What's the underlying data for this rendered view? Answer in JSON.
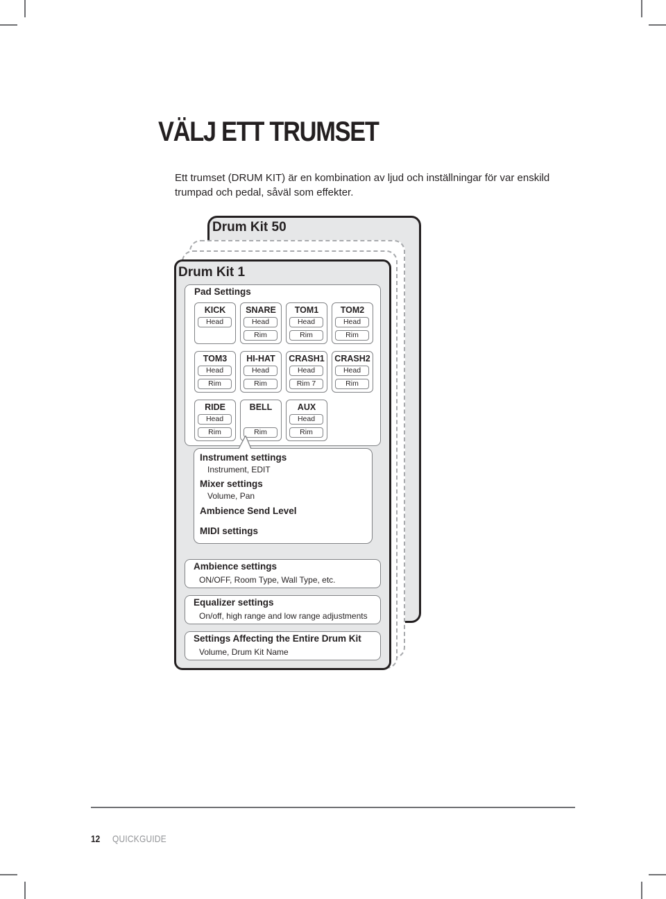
{
  "page": {
    "title": "VÄLJ ETT TRUMSET",
    "intro": "Ett trumset (DRUM KIT) är en kombination av ljud och inställningar för var enskild trumpad och pedal, såväl som effekter.",
    "footer": {
      "page_number": "12",
      "label": "QUICKGUIDE"
    }
  },
  "diagram": {
    "back_kit_title": "Drum Kit 50",
    "front_kit_title": "Drum Kit 1",
    "pad_settings_label": "Pad Settings",
    "pads": [
      {
        "name": "KICK",
        "head": "Head",
        "rim": null
      },
      {
        "name": "SNARE",
        "head": "Head",
        "rim": "Rim"
      },
      {
        "name": "TOM1",
        "head": "Head",
        "rim": "Rim"
      },
      {
        "name": "TOM2",
        "head": "Head",
        "rim": "Rim"
      },
      {
        "name": "TOM3",
        "head": "Head",
        "rim": "Rim"
      },
      {
        "name": "HI-HAT",
        "head": "Head",
        "rim": "Rim"
      },
      {
        "name": "CRASH1",
        "head": "Head",
        "rim": "Rim 7"
      },
      {
        "name": "CRASH2",
        "head": "Head",
        "rim": "Rim"
      },
      {
        "name": "RIDE",
        "head": "Head",
        "rim": "Rim"
      },
      {
        "name": "BELL",
        "head": null,
        "rim": "Rim"
      },
      {
        "name": "AUX",
        "head": "Head",
        "rim": "Rim"
      }
    ],
    "zone_settings": [
      {
        "title": "Instrument settings",
        "detail": "Instrument, EDIT"
      },
      {
        "title": "Mixer settings",
        "detail": "Volume, Pan"
      },
      {
        "title": "Ambience Send Level",
        "detail": null
      },
      {
        "title": "MIDI settings",
        "detail": null
      }
    ],
    "kit_settings": [
      {
        "title": "Ambience settings",
        "detail": "ON/OFF, Room Type, Wall Type, etc."
      },
      {
        "title": "Equalizer settings",
        "detail": "On/off, high range and low range adjustments"
      },
      {
        "title": "Settings Affecting the Entire Drum Kit",
        "detail": "Volume, Drum Kit Name"
      }
    ]
  }
}
